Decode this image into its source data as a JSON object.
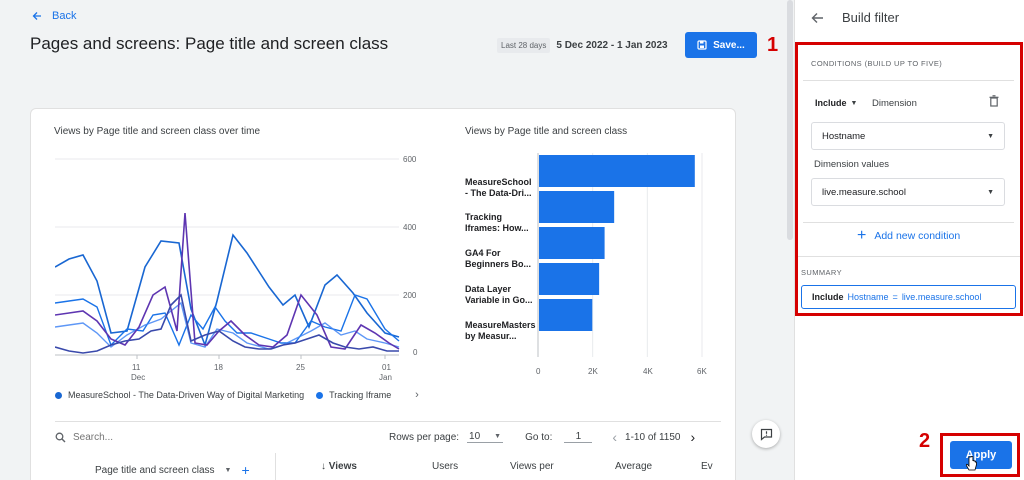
{
  "header": {
    "back_label": "Back",
    "page_title": "Pages and screens: Page title and screen class",
    "date_chip": "Last 28 days",
    "date_range": "5 Dec 2022 - 1 Jan 2023",
    "save_label": "Save...",
    "marker_1": "1"
  },
  "line_chart": {
    "title": "Views by Page title and screen class over time",
    "y_ticks": [
      "600",
      "400",
      "200",
      "0"
    ],
    "x_ticks": [
      {
        "label": "11",
        "sub": "Dec"
      },
      {
        "label": "18",
        "sub": ""
      },
      {
        "label": "25",
        "sub": ""
      },
      {
        "label": "01",
        "sub": "Jan"
      }
    ],
    "legend": [
      {
        "label": "MeasureSchool - The Data-Driven Way of Digital Marketing",
        "color": "#1967d2"
      },
      {
        "label": "Tracking Iframe",
        "color": "#1a73e8"
      }
    ]
  },
  "chart_data": {
    "type": "bar",
    "title": "Views by Page title and screen class",
    "categories": [
      "MeasureSchool - The Data-Dri...",
      "Tracking Iframes: How...",
      "GA4 For Beginners Bo...",
      "Data Layer Variable in Go...",
      "MeasureMasters by Measur..."
    ],
    "values": [
      5700,
      2750,
      2400,
      2200,
      1950
    ],
    "x_ticks": [
      "0",
      "2K",
      "4K",
      "6K"
    ],
    "xlim": [
      0,
      6000
    ],
    "color": "#1a73e8"
  },
  "table": {
    "search_placeholder": "Search...",
    "rows_per_page_label": "Rows per page:",
    "rows_per_page_value": "10",
    "goto_label": "Go to:",
    "goto_value": "1",
    "pagination": "1-10 of 1150",
    "columns": {
      "dimension": "Page title and screen class",
      "views": "Views",
      "users": "Users",
      "views_per": "Views per",
      "average": "Average",
      "ev": "Ev"
    }
  },
  "panel": {
    "title": "Build filter",
    "conditions_label": "CONDITIONS (BUILD UP TO FIVE)",
    "include_label": "Include",
    "dimension_label": "Dimension",
    "dimension_select": "Hostname",
    "dimension_values_label": "Dimension values",
    "dimension_value_select": "live.measure.school",
    "add_condition": "Add new condition",
    "summary_label": "SUMMARY",
    "summary_include": "Include",
    "summary_hostname": "Hostname",
    "summary_eq": "=",
    "summary_value": "live.measure.school",
    "apply_label": "Apply",
    "marker_2": "2"
  }
}
